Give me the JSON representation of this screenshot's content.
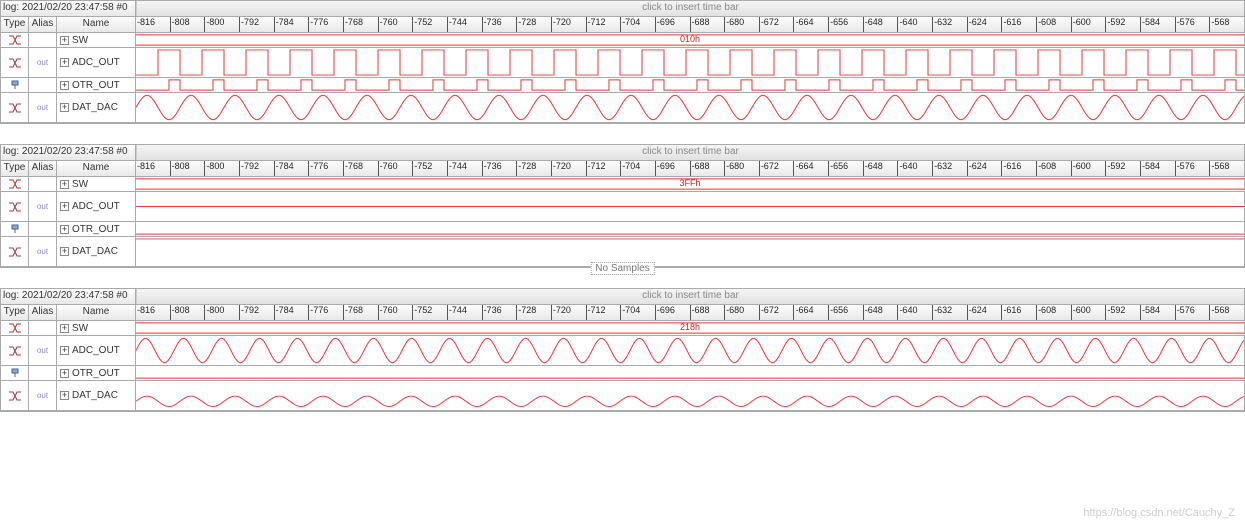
{
  "watermark": "https://blog.csdn.net/Cauchy_Z",
  "ruler_start": -816,
  "ruler_end": -568,
  "ruler_step": 8,
  "header": {
    "type": "Type",
    "alias": "Alias",
    "name": "Name"
  },
  "timebar_hint": "click to insert time bar",
  "panels": [
    {
      "log": "log: 2021/02/20 23:47:58  #0",
      "bus_value": "010h",
      "no_samples": false,
      "rows": [
        {
          "name": "SW",
          "height": "short",
          "wave": "bus",
          "alias_icon": "bus"
        },
        {
          "name": "ADC_OUT",
          "height": "tall",
          "wave": "square",
          "alias_icon": "out"
        },
        {
          "name": "OTR_OUT",
          "height": "short",
          "wave": "pulse",
          "alias_icon": "pin"
        },
        {
          "name": "DAT_DAC",
          "height": "tall",
          "wave": "sine",
          "alias_icon": "out"
        }
      ]
    },
    {
      "log": "log: 2021/02/20 23:47:58  #0",
      "bus_value": "3FFh",
      "no_samples": true,
      "rows": [
        {
          "name": "SW",
          "height": "short",
          "wave": "bus",
          "alias_icon": "bus"
        },
        {
          "name": "ADC_OUT",
          "height": "tall",
          "wave": "flat-mid",
          "alias_icon": "out"
        },
        {
          "name": "OTR_OUT",
          "height": "short",
          "wave": "flat-low",
          "alias_icon": "pin"
        },
        {
          "name": "DAT_DAC",
          "height": "tall",
          "wave": "flat-top",
          "alias_icon": "out"
        }
      ]
    },
    {
      "log": "log: 2021/02/20 23:47:58  #0",
      "bus_value": "218h",
      "no_samples": false,
      "rows": [
        {
          "name": "SW",
          "height": "short",
          "wave": "bus",
          "alias_icon": "bus"
        },
        {
          "name": "ADC_OUT",
          "height": "tall",
          "wave": "sine-fast",
          "alias_icon": "out"
        },
        {
          "name": "OTR_OUT",
          "height": "short",
          "wave": "flat-low",
          "alias_icon": "pin"
        },
        {
          "name": "DAT_DAC",
          "height": "tall",
          "wave": "sine-low",
          "alias_icon": "out"
        }
      ]
    }
  ]
}
